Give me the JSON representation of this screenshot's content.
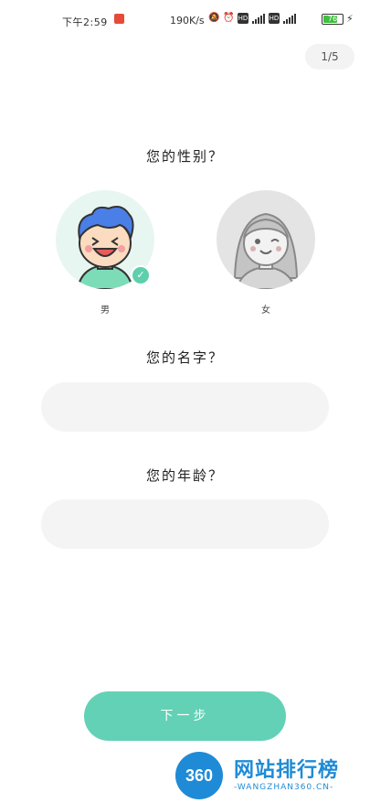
{
  "status_bar": {
    "time": "下午2:59",
    "speed": "190K/s",
    "battery": "76"
  },
  "pager": {
    "text": "1/5"
  },
  "gender": {
    "question": "您的性别？",
    "male_label": "男",
    "female_label": "女",
    "selected": "男"
  },
  "name": {
    "question": "您的名字？",
    "value": ""
  },
  "age": {
    "question": "您的年龄？",
    "value": ""
  },
  "next_button": {
    "label": "下一步"
  },
  "watermark": {
    "logo": "360",
    "title": "网站排行榜",
    "subtitle": "-WANGZHAN360.CN-"
  }
}
